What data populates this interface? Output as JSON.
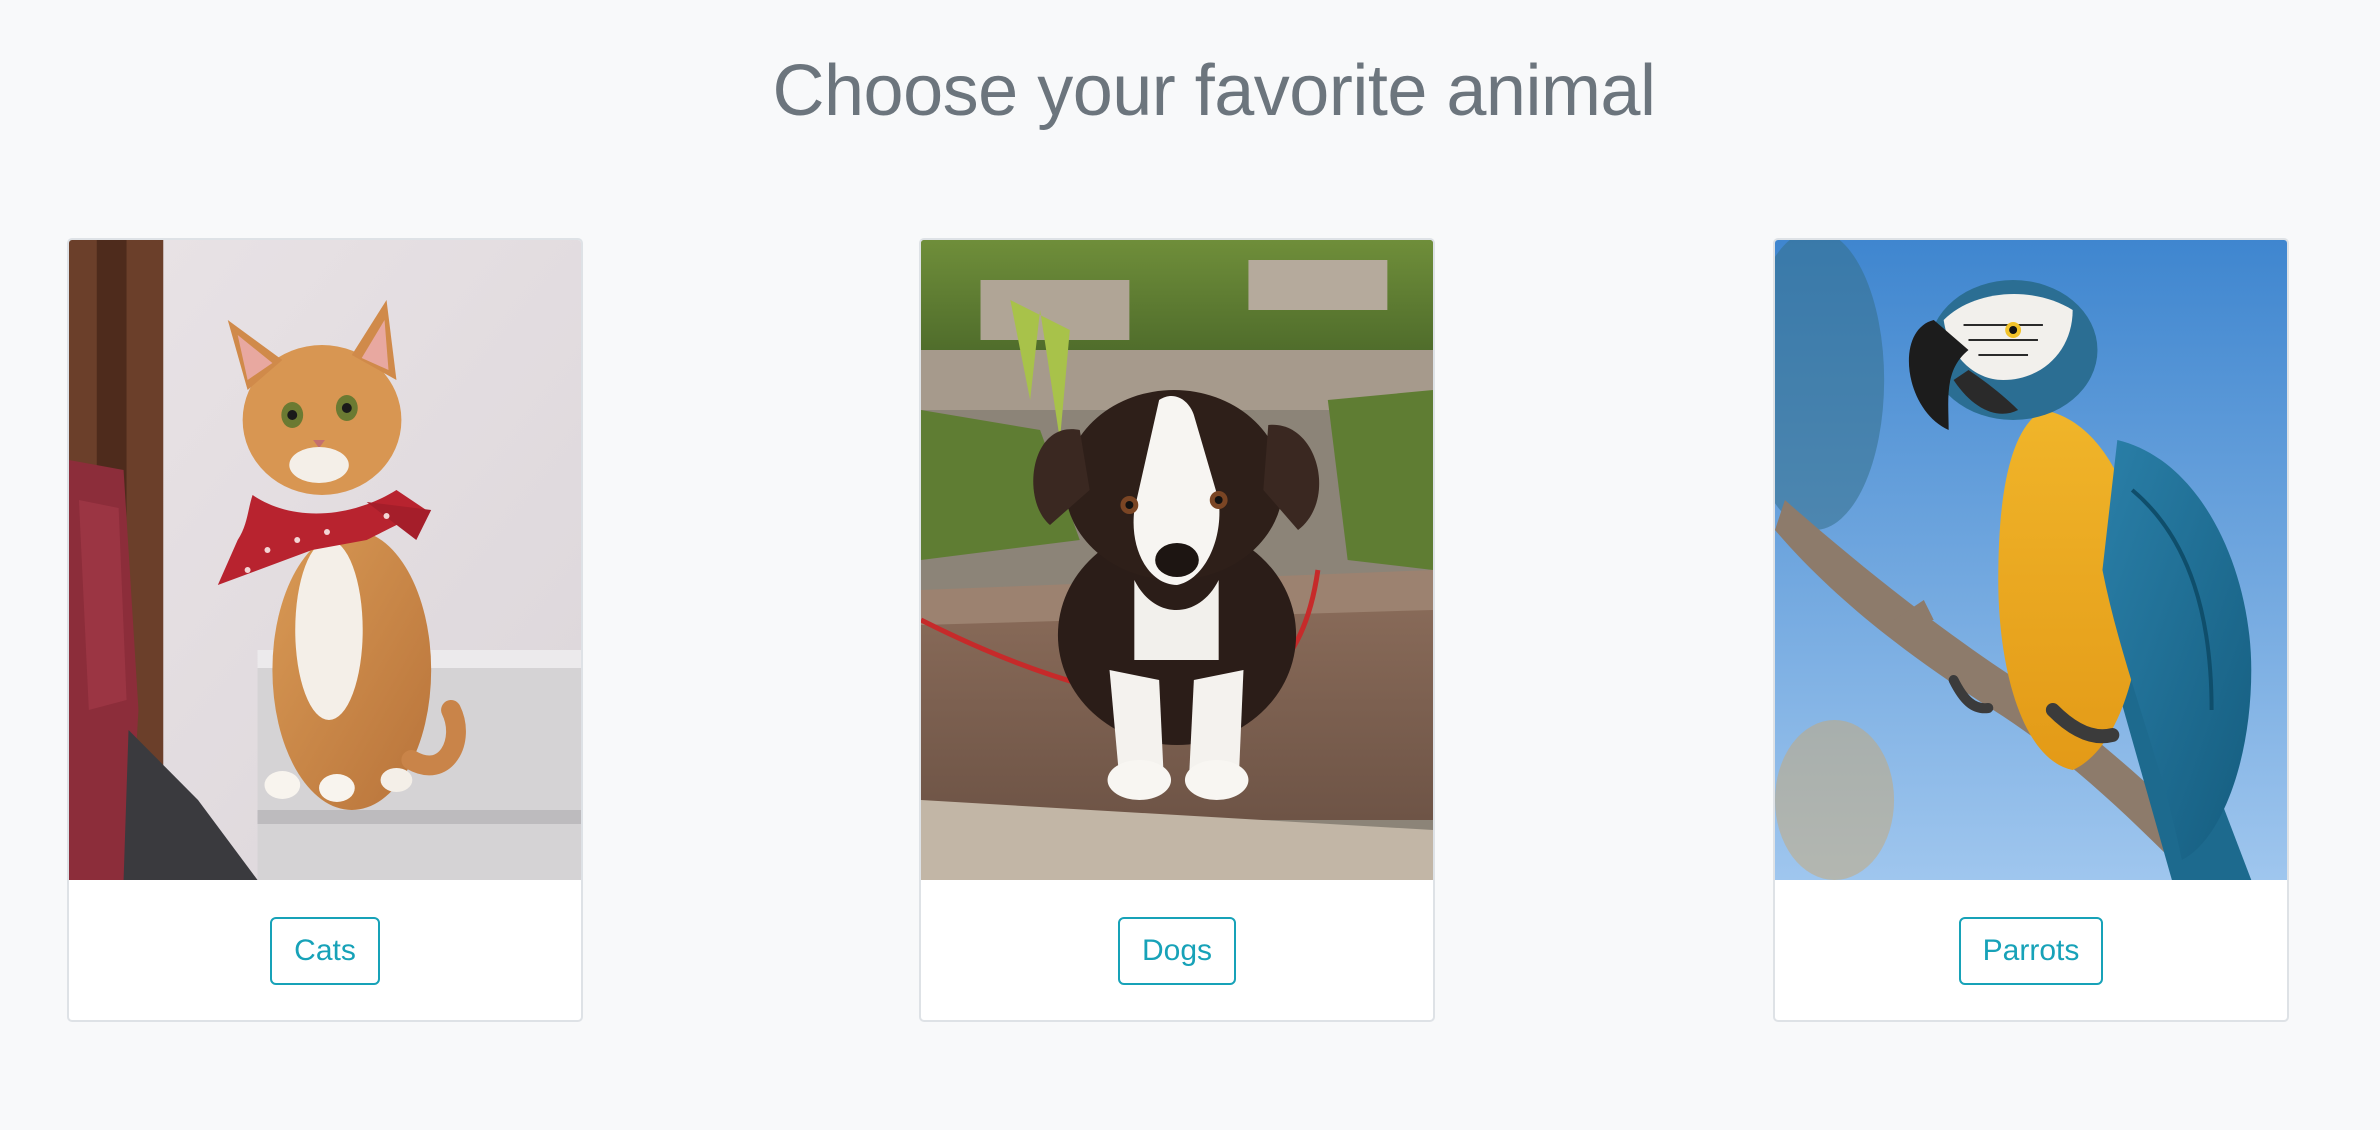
{
  "page": {
    "title": "Choose your favorite animal"
  },
  "cards": [
    {
      "image_alt": "Ginger cat wearing a red bandana",
      "button_label": "Cats"
    },
    {
      "image_alt": "Black and white puppy on stone steps",
      "button_label": "Dogs"
    },
    {
      "image_alt": "Blue and yellow macaw on a branch",
      "button_label": "Parrots"
    }
  ],
  "colors": {
    "background": "#f8f9fa",
    "title": "#6c757d",
    "button_accent": "#17a2b8",
    "card_border": "#dee2e6"
  }
}
